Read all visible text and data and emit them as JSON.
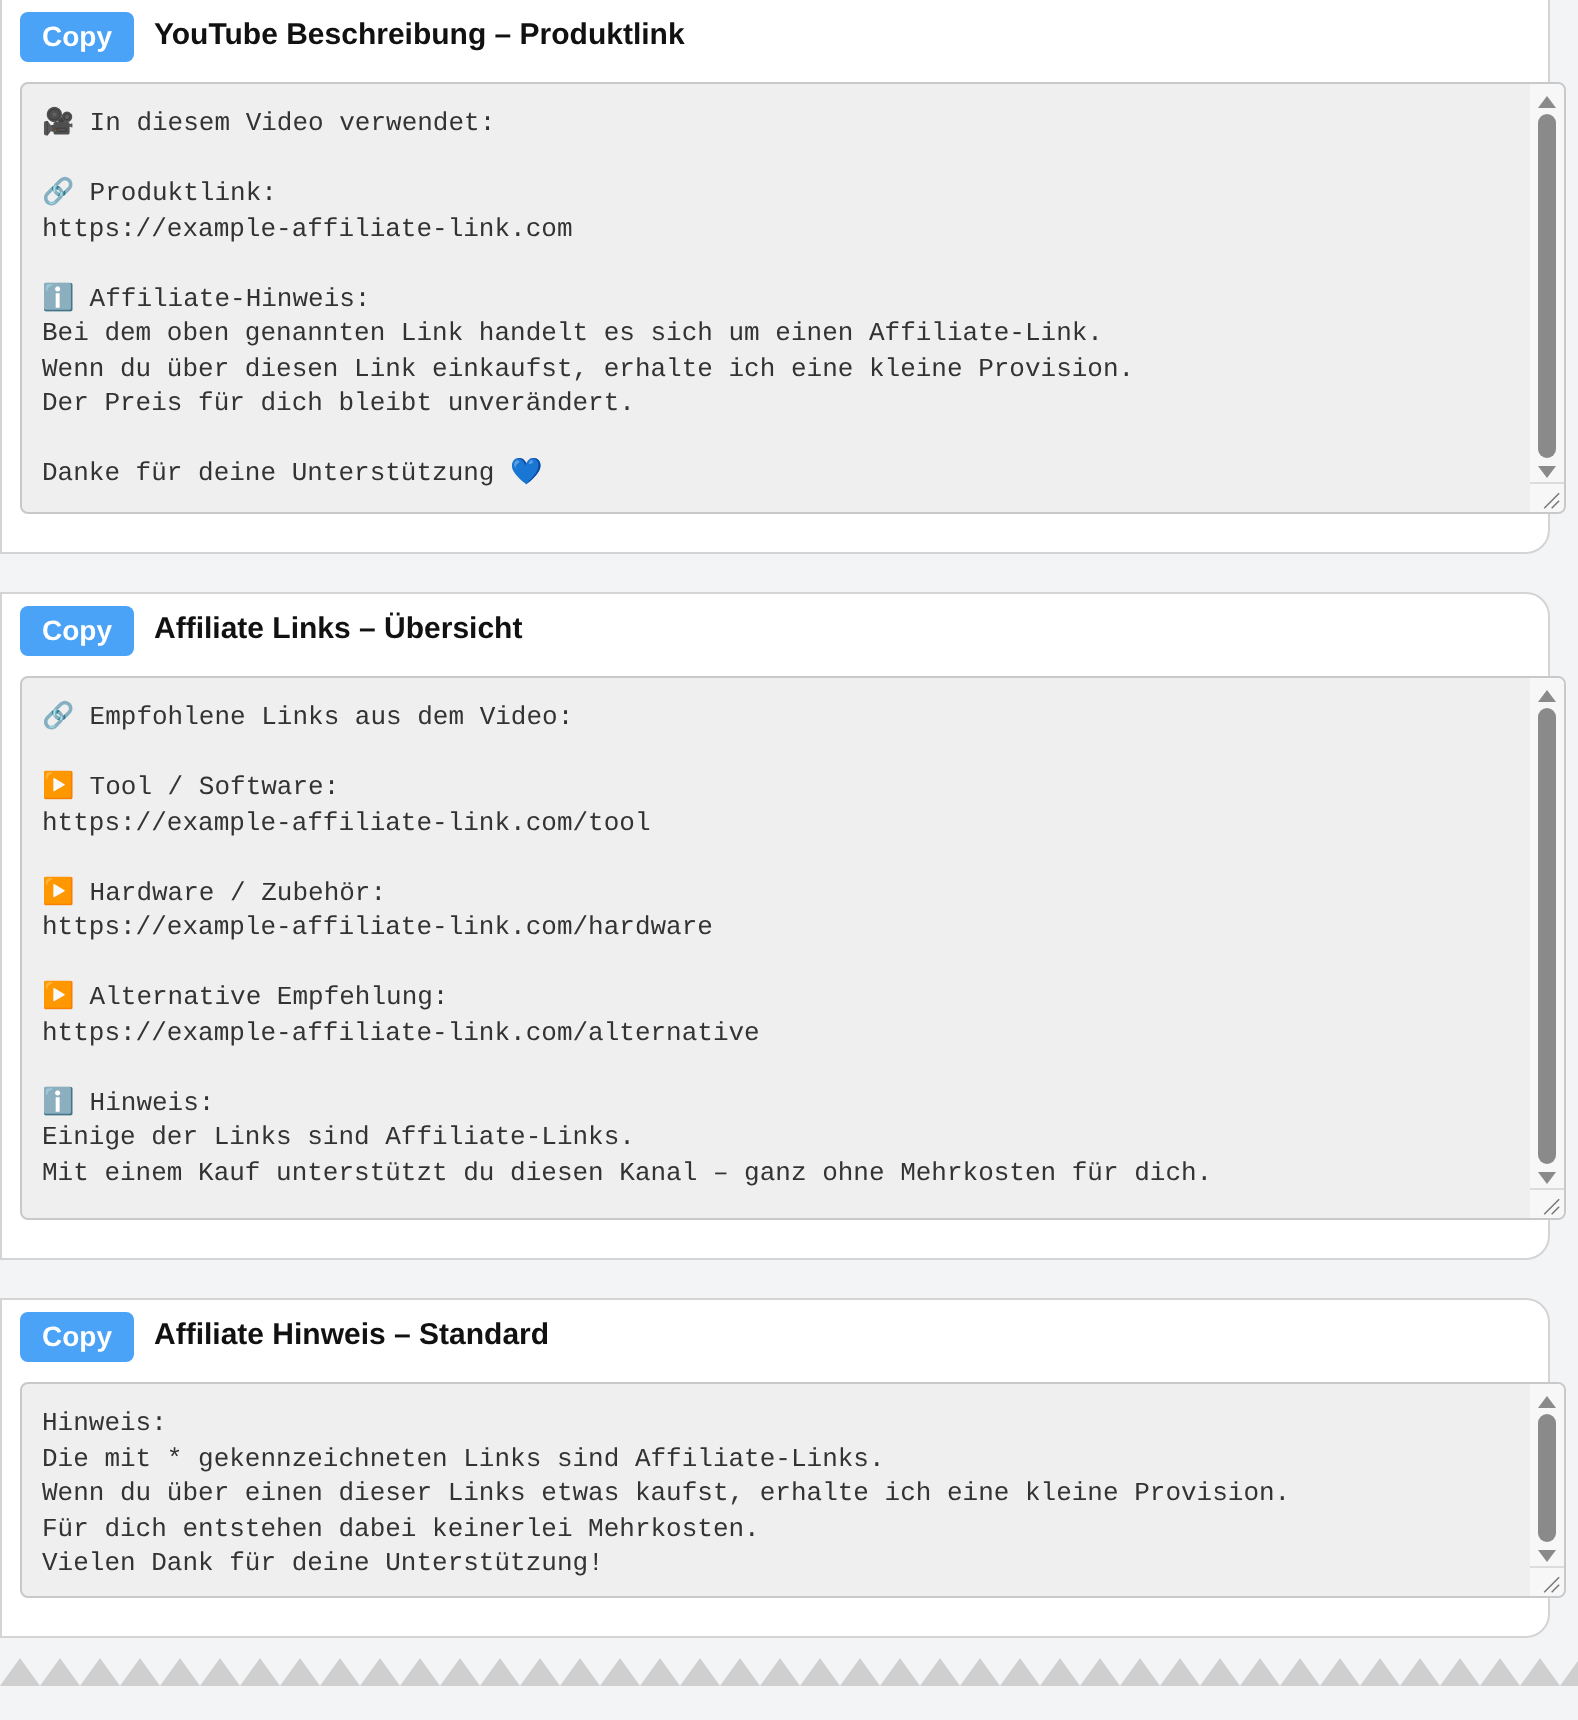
{
  "cards": [
    {
      "button": "Copy",
      "title": "YouTube Beschreibung – Produktlink",
      "text": "🎥 In diesem Video verwendet:\n\n🔗 Produktlink:\nhttps://example-affiliate-link.com\n\nℹ️ Affiliate-Hinweis:\nBei dem oben genannten Link handelt es sich um einen Affiliate-Link.\nWenn du über diesen Link einkaufst, erhalte ich eine kleine Provision.\nDer Preis für dich bleibt unverändert.\n\nDanke für deine Unterstützung 💙"
    },
    {
      "button": "Copy",
      "title": "Affiliate Links – Übersicht",
      "text": "🔗 Empfohlene Links aus dem Video:\n\n▶️ Tool / Software:\nhttps://example-affiliate-link.com/tool\n\n▶️ Hardware / Zubehör:\nhttps://example-affiliate-link.com/hardware\n\n▶️ Alternative Empfehlung:\nhttps://example-affiliate-link.com/alternative\n\nℹ️ Hinweis:\nEinige der Links sind Affiliate-Links.\nMit einem Kauf unterstützt du diesen Kanal – ganz ohne Mehrkosten für dich."
    },
    {
      "button": "Copy",
      "title": "Affiliate Hinweis – Standard",
      "text": "Hinweis:\nDie mit * gekennzeichneten Links sind Affiliate-Links.\nWenn du über einen dieser Links etwas kaufst, erhalte ich eine kleine Provision.\nFür dich entstehen dabei keinerlei Mehrkosten.\nVielen Dank für deine Unterstützung!"
    }
  ]
}
